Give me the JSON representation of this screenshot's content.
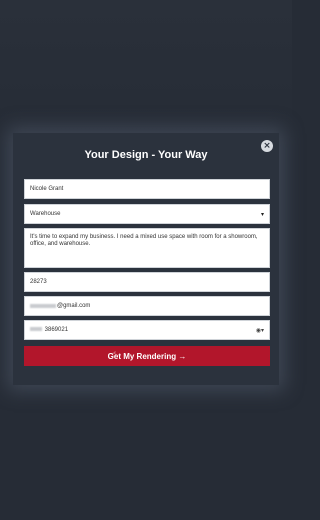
{
  "modal": {
    "title": "Your Design - Your Way",
    "close_glyph": "×"
  },
  "form": {
    "name_value": "Nicole Grant",
    "building_type_value": "Warehouse",
    "description_value": "It's time to expand my business. I need a mixed use space with room for a showroom, office, and warehouse.",
    "zip_value": "28273",
    "email_suffix": "@gmail.com",
    "phone_suffix": "3869021",
    "dropdown_caret": "▾",
    "phone_icon": "◉▾"
  },
  "submit": {
    "label": "Get My Rendering →"
  },
  "icons": {
    "close": "close-icon",
    "caret": "chevron-down-icon",
    "pointer": "hand-pointer-icon"
  },
  "colors": {
    "background": "#262c36",
    "modal": "#2b323d",
    "button": "#b2162b"
  }
}
